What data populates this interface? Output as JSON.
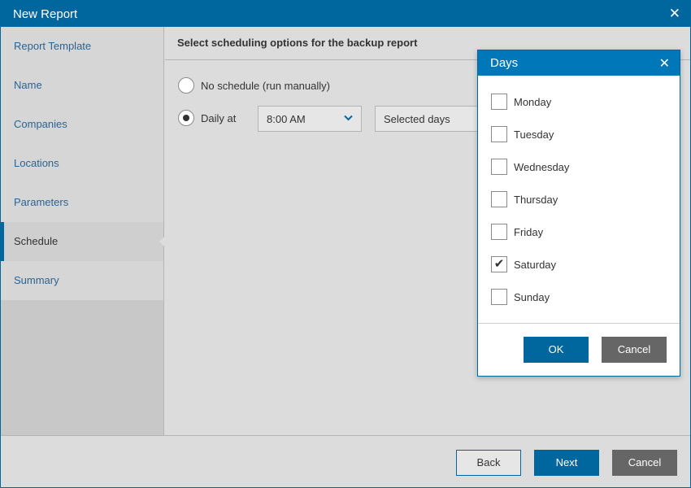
{
  "window": {
    "title": "New Report"
  },
  "sidebar": {
    "items": [
      {
        "label": "Report Template"
      },
      {
        "label": "Name"
      },
      {
        "label": "Companies"
      },
      {
        "label": "Locations"
      },
      {
        "label": "Parameters"
      },
      {
        "label": "Schedule",
        "active": true
      },
      {
        "label": "Summary"
      }
    ]
  },
  "main": {
    "header": "Select scheduling options for the backup report",
    "options": {
      "no_schedule": "No schedule (run manually)",
      "daily_at": "Daily at",
      "time": "8:00 AM",
      "days_select": "Selected days",
      "selected": "daily_at"
    }
  },
  "footer": {
    "back": "Back",
    "next": "Next",
    "cancel": "Cancel"
  },
  "dialog": {
    "title": "Days",
    "days": [
      {
        "label": "Monday",
        "checked": false
      },
      {
        "label": "Tuesday",
        "checked": false
      },
      {
        "label": "Wednesday",
        "checked": false
      },
      {
        "label": "Thursday",
        "checked": false
      },
      {
        "label": "Friday",
        "checked": false
      },
      {
        "label": "Saturday",
        "checked": true
      },
      {
        "label": "Sunday",
        "checked": false
      }
    ],
    "ok": "OK",
    "cancel": "Cancel"
  },
  "icons": {
    "close": "close-icon",
    "chevron": "chevron-down-icon",
    "check": "check-icon"
  },
  "colors": {
    "accent": "#00669e",
    "dialog_header": "#0077b8",
    "cancel_button": "#666666"
  }
}
